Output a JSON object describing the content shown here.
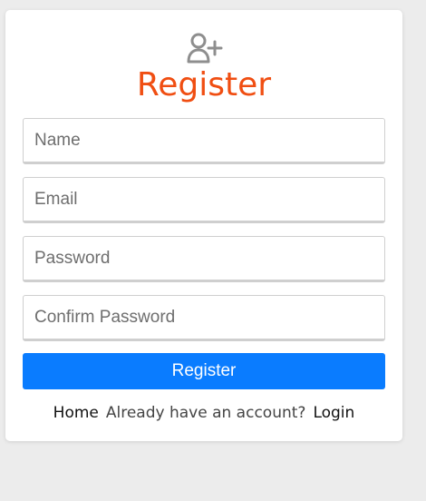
{
  "colors": {
    "page_background": "#ececec",
    "card_background": "#ffffff",
    "accent": "#f04e12",
    "button": "#0a7cff",
    "icon": "#8e8e8e"
  },
  "header": {
    "icon": "user-plus-icon",
    "title": "Register"
  },
  "form": {
    "name_placeholder": "Name",
    "email_placeholder": "Email",
    "password_placeholder": "Password",
    "confirm_password_placeholder": "Confirm Password",
    "submit_label": "Register"
  },
  "footer": {
    "home_link": "Home",
    "prompt": "Already have an account?",
    "login_link": "Login"
  }
}
